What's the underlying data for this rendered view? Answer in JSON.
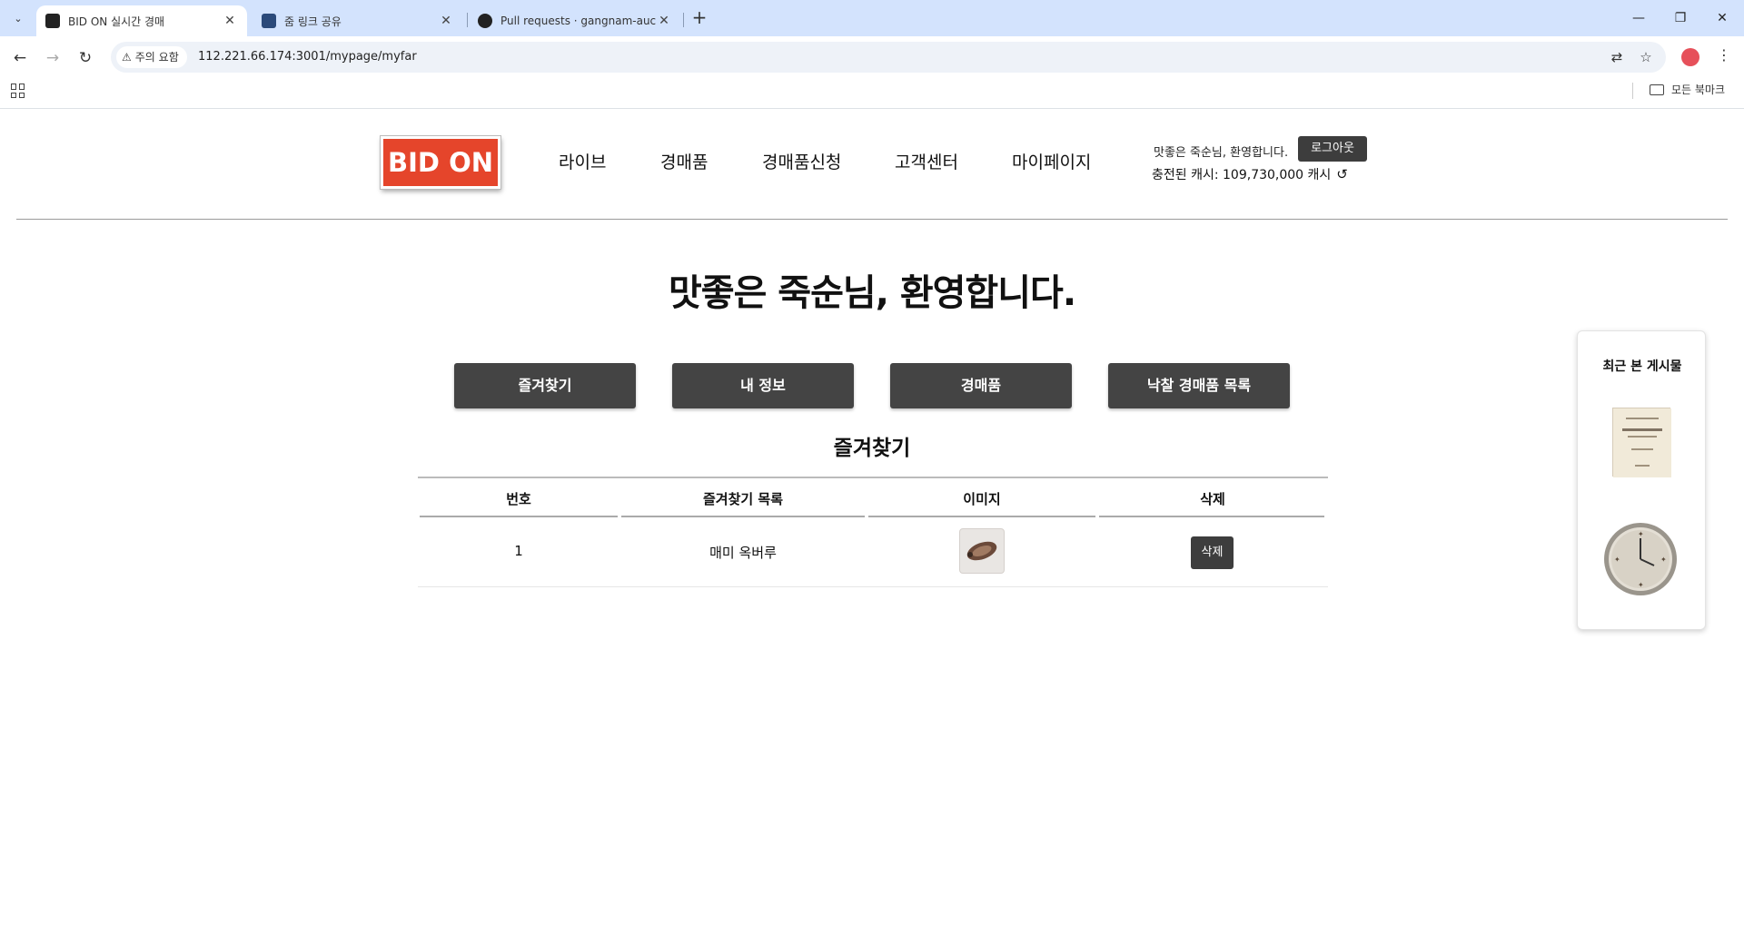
{
  "browser": {
    "tabs": [
      {
        "title": "BID ON 실시간 경매",
        "active": true
      },
      {
        "title": "줌 링크 공유",
        "active": false
      },
      {
        "title": "Pull requests · gangnam-auctio",
        "active": false
      }
    ],
    "security_label": "주의 요함",
    "url": "112.221.66.174:3001/mypage/myfar",
    "all_bookmarks_label": "모든 북마크"
  },
  "site": {
    "logo_text": "BID ON",
    "nav": [
      "라이브",
      "경매품",
      "경매품신청",
      "고객센터",
      "마이페이지"
    ],
    "welcome_small": "맛좋은 죽순님, 환영합니다.",
    "logout_label": "로그아웃",
    "cash_text": "충전된 캐시: 109,730,000 캐시"
  },
  "mypage": {
    "heading": "맛좋은 죽순님, 환영합니다.",
    "tabs": [
      "즐겨찾기",
      "내 정보",
      "경매품",
      "낙찰 경매품 목록"
    ],
    "section_title": "즐겨찾기",
    "table": {
      "headers": [
        "번호",
        "즐겨찾기 목록",
        "이미지",
        "삭제"
      ],
      "rows": [
        {
          "number": "1",
          "name": "매미 옥버루",
          "image": "cicada-ornament",
          "delete_label": "삭제"
        }
      ]
    }
  },
  "recent": {
    "title": "최근 본 게시물",
    "items": [
      "old-book-thumbnail",
      "wall-clock-thumbnail"
    ]
  },
  "colors": {
    "tab_bar": "#d3e3fd",
    "logo_red": "#e5452b",
    "dark_button": "#444444"
  }
}
